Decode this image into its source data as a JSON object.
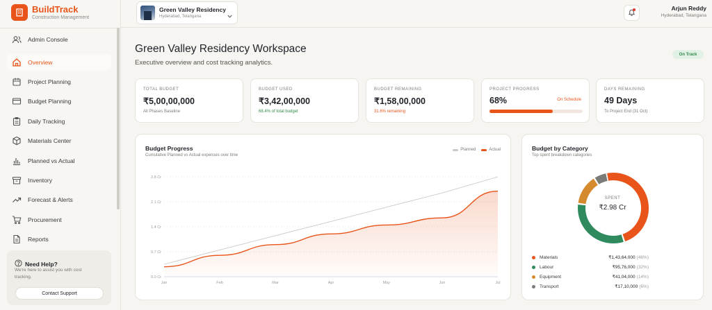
{
  "app": {
    "name": "BuildTrack",
    "subtitle": "Construction Management"
  },
  "sidebar": {
    "items": [
      {
        "label": "Admin Console",
        "icon": "users-icon"
      },
      {
        "label": "Overview",
        "icon": "home-icon",
        "active": true
      },
      {
        "label": "Project Planning",
        "icon": "calendar-icon"
      },
      {
        "label": "Budget Planning",
        "icon": "wallet-icon"
      },
      {
        "label": "Daily Tracking",
        "icon": "clipboard-icon"
      },
      {
        "label": "Materials Center",
        "icon": "box-icon"
      },
      {
        "label": "Planned vs Actual",
        "icon": "bar-chart-icon"
      },
      {
        "label": "Inventory",
        "icon": "archive-icon"
      },
      {
        "label": "Forecast & Alerts",
        "icon": "trend-icon"
      },
      {
        "label": "Procurement",
        "icon": "cart-icon"
      },
      {
        "label": "Reports",
        "icon": "file-icon"
      }
    ],
    "help": {
      "title": "Need Help?",
      "text": "We're here to assist you with cost tracking.",
      "button": "Contact Support"
    }
  },
  "topbar": {
    "project": {
      "name": "Green Valley Residency",
      "location": "Hyderabad, Telangana"
    },
    "user": {
      "name": "Arjun Reddy",
      "location": "Hyderabad, Telangana"
    }
  },
  "page": {
    "title": "Green Valley Residency Workspace",
    "subtitle": "Executive overview and cost tracking analytics.",
    "status": "On Track"
  },
  "kpis": [
    {
      "label": "TOTAL BUDGET",
      "value": "₹5,00,00,000",
      "note": "All Phases Baseline"
    },
    {
      "label": "BUDGET USED",
      "value": "₹3,42,00,000",
      "note": "68.4% of total budget"
    },
    {
      "label": "BUDGET REMAINING",
      "value": "₹1,58,00,000",
      "note": "31.6% remaining"
    },
    {
      "label": "PROJECT PROGRESS",
      "value": "68%",
      "badge": "On Schedule",
      "progress": 0.68
    },
    {
      "label": "DAYS REMAINING",
      "value": "49 Days",
      "note": "To Project End (31 Oct)"
    }
  ],
  "budget_progress": {
    "title": "Budget Progress",
    "subtitle": "Cumulative Planned vs Actual expenses over time",
    "legend": {
      "planned": "Planned",
      "actual": "Actual"
    }
  },
  "budget_category": {
    "title": "Budget by Category",
    "subtitle": "Top spent breakdown categories",
    "center_label": "SPENT",
    "center_value": "₹2.98 Cr",
    "categories": [
      {
        "name": "Materials",
        "value": "₹1,43,64,000",
        "pct": "(48%)",
        "color": "#e8541a"
      },
      {
        "name": "Labour",
        "value": "₹95,76,000",
        "pct": "(32%)",
        "color": "#2f8a5e"
      },
      {
        "name": "Equipment",
        "value": "₹41,04,000",
        "pct": "(14%)",
        "color": "#d68a2e"
      },
      {
        "name": "Transport",
        "value": "₹17,10,000",
        "pct": "(6%)",
        "color": "#7b7b77"
      }
    ]
  },
  "colors": {
    "accent": "#e8541a",
    "success": "#2f8a4a",
    "planned": "#c9c9c5"
  },
  "chart_data": [
    {
      "type": "line",
      "title": "Budget Progress",
      "subtitle": "Cumulative Planned vs Actual expenses over time",
      "x": [
        "Jan",
        "Feb",
        "Mar",
        "Apr",
        "May",
        "Jun",
        "Jul"
      ],
      "y_ticks": [
        "0.0 Cr",
        "0.7 Cr",
        "1.4 Cr",
        "2.1 Cr",
        "2.8 Cr"
      ],
      "ylim": [
        0,
        2.8
      ],
      "series": [
        {
          "name": "Planned",
          "values": [
            0.35,
            0.75,
            1.15,
            1.55,
            1.95,
            2.35,
            2.8
          ],
          "color": "#c9c9c5"
        },
        {
          "name": "Actual",
          "values": [
            0.28,
            0.6,
            0.9,
            1.2,
            1.45,
            1.65,
            2.4
          ],
          "color": "#e8541a"
        }
      ],
      "grid": true,
      "legend": "top-right"
    },
    {
      "type": "pie",
      "title": "Budget by Category",
      "subtitle": "Top spent breakdown categories",
      "categories": [
        "Materials",
        "Labour",
        "Equipment",
        "Transport"
      ],
      "values": [
        48,
        32,
        14,
        6
      ]
    }
  ]
}
